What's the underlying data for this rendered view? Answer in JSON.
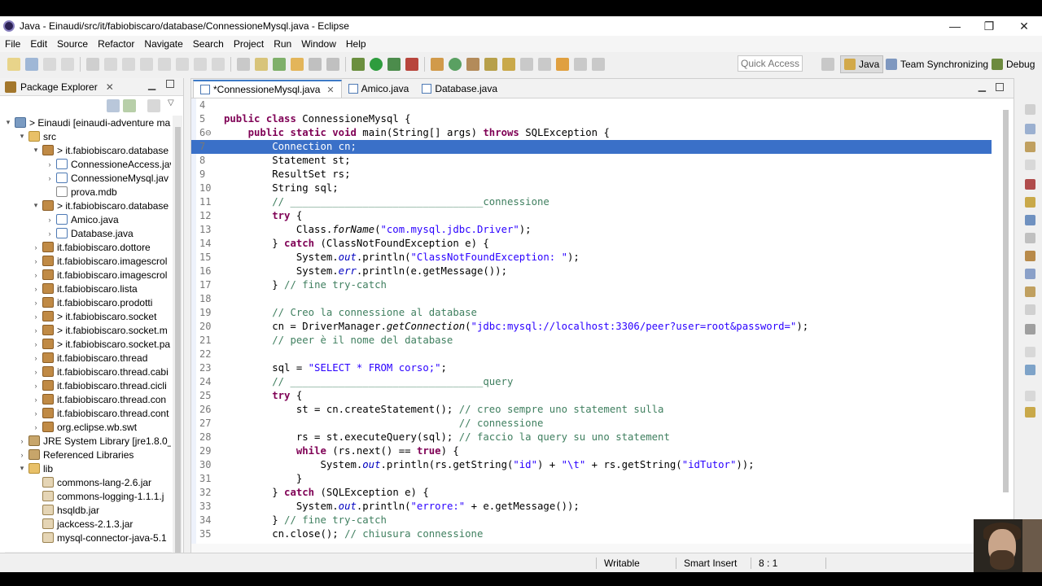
{
  "window": {
    "title": "Java - Einaudi/src/it/fabiobiscaro/database/ConnessioneMysql.java - Eclipse",
    "minimize": "—",
    "restore": "❐",
    "close": "✕"
  },
  "menu": [
    "File",
    "Edit",
    "Source",
    "Refactor",
    "Navigate",
    "Search",
    "Project",
    "Run",
    "Window",
    "Help"
  ],
  "toolbar": {
    "quick_access_placeholder": "Quick Access",
    "perspectives": [
      {
        "label": "Java",
        "active": true
      },
      {
        "label": "Team Synchronizing",
        "active": false
      },
      {
        "label": "Debug",
        "active": false
      }
    ]
  },
  "package_explorer": {
    "title": "Package Explorer",
    "close": "✕",
    "tree": [
      {
        "label": "> Einaudi  [einaudi-adventure ma",
        "icon": "project",
        "twisty": "▾",
        "level": 0
      },
      {
        "label": "src",
        "icon": "folder",
        "twisty": "▾",
        "level": 1
      },
      {
        "label": "> it.fabiobiscaro.database",
        "icon": "package",
        "twisty": "▾",
        "level": 2
      },
      {
        "label": "ConnessioneAccess.jav",
        "icon": "java",
        "twisty": "›",
        "level": 3
      },
      {
        "label": "ConnessioneMysql.jav",
        "icon": "java",
        "twisty": "›",
        "level": 3
      },
      {
        "label": "prova.mdb",
        "icon": "file",
        "twisty": "",
        "level": 3
      },
      {
        "label": "> it.fabiobiscaro.database",
        "icon": "package",
        "twisty": "▾",
        "level": 2
      },
      {
        "label": "Amico.java",
        "icon": "java",
        "twisty": "›",
        "level": 3
      },
      {
        "label": "Database.java",
        "icon": "java",
        "twisty": "›",
        "level": 3
      },
      {
        "label": "it.fabiobiscaro.dottore",
        "icon": "package",
        "twisty": "›",
        "level": 2
      },
      {
        "label": "it.fabiobiscaro.imagescrol",
        "icon": "package",
        "twisty": "›",
        "level": 2
      },
      {
        "label": "it.fabiobiscaro.imagescrol",
        "icon": "package",
        "twisty": "›",
        "level": 2
      },
      {
        "label": "it.fabiobiscaro.lista",
        "icon": "package",
        "twisty": "›",
        "level": 2
      },
      {
        "label": "it.fabiobiscaro.prodotti",
        "icon": "package",
        "twisty": "›",
        "level": 2
      },
      {
        "label": "> it.fabiobiscaro.socket",
        "icon": "package",
        "twisty": "›",
        "level": 2
      },
      {
        "label": "> it.fabiobiscaro.socket.m",
        "icon": "package",
        "twisty": "›",
        "level": 2
      },
      {
        "label": "> it.fabiobiscaro.socket.pa",
        "icon": "package",
        "twisty": "›",
        "level": 2
      },
      {
        "label": "it.fabiobiscaro.thread",
        "icon": "package",
        "twisty": "›",
        "level": 2
      },
      {
        "label": "it.fabiobiscaro.thread.cabi",
        "icon": "package",
        "twisty": "›",
        "level": 2
      },
      {
        "label": "it.fabiobiscaro.thread.cicli",
        "icon": "package",
        "twisty": "›",
        "level": 2
      },
      {
        "label": "it.fabiobiscaro.thread.con",
        "icon": "package",
        "twisty": "›",
        "level": 2
      },
      {
        "label": "it.fabiobiscaro.thread.cont",
        "icon": "package",
        "twisty": "›",
        "level": 2
      },
      {
        "label": "org.eclipse.wb.swt",
        "icon": "package",
        "twisty": "›",
        "level": 2
      },
      {
        "label": "JRE System Library [jre1.8.0_1",
        "icon": "library",
        "twisty": "›",
        "level": 1
      },
      {
        "label": "Referenced Libraries",
        "icon": "library",
        "twisty": "›",
        "level": 1
      },
      {
        "label": "lib",
        "icon": "folder",
        "twisty": "▾",
        "level": 1
      },
      {
        "label": "commons-lang-2.6.jar",
        "icon": "jar",
        "twisty": "",
        "level": 2
      },
      {
        "label": "commons-logging-1.1.1.j",
        "icon": "jar",
        "twisty": "",
        "level": 2
      },
      {
        "label": "hsqldb.jar",
        "icon": "jar",
        "twisty": "",
        "level": 2
      },
      {
        "label": "jackcess-2.1.3.jar",
        "icon": "jar",
        "twisty": "",
        "level": 2
      },
      {
        "label": "mysql-connector-java-5.1",
        "icon": "jar",
        "twisty": "",
        "level": 2
      }
    ]
  },
  "editor": {
    "tabs": [
      {
        "label": "*ConnessioneMysql.java",
        "active": true,
        "close": "✕"
      },
      {
        "label": "Amico.java",
        "active": false,
        "close": ""
      },
      {
        "label": "Database.java",
        "active": false,
        "close": ""
      }
    ],
    "selected_line": 7,
    "lines": [
      {
        "n": "4",
        "t": ""
      },
      {
        "n": "5",
        "t": "public class ConnessioneMysql {"
      },
      {
        "n": "6⊖",
        "t": "    public static void main(String[] args) throws SQLException {"
      },
      {
        "n": "7",
        "t": "        Connection cn;"
      },
      {
        "n": "8",
        "t": "        Statement st;"
      },
      {
        "n": "9",
        "t": "        ResultSet rs;"
      },
      {
        "n": "10",
        "t": "        String sql;"
      },
      {
        "n": "11",
        "t": "        // ________________________________connessione"
      },
      {
        "n": "12",
        "t": "        try {"
      },
      {
        "n": "13",
        "t": "            Class.forName(\"com.mysql.jdbc.Driver\");"
      },
      {
        "n": "14",
        "t": "        } catch (ClassNotFoundException e) {"
      },
      {
        "n": "15",
        "t": "            System.out.println(\"ClassNotFoundException: \");"
      },
      {
        "n": "16",
        "t": "            System.err.println(e.getMessage());"
      },
      {
        "n": "17",
        "t": "        } // fine try-catch"
      },
      {
        "n": "18",
        "t": ""
      },
      {
        "n": "19",
        "t": "        // Creo la connessione al database"
      },
      {
        "n": "20",
        "t": "        cn = DriverManager.getConnection(\"jdbc:mysql://localhost:3306/peer?user=root&password=\");"
      },
      {
        "n": "21",
        "t": "        // peer è il nome del database"
      },
      {
        "n": "22",
        "t": ""
      },
      {
        "n": "23",
        "t": "        sql = \"SELECT * FROM corso;\";"
      },
      {
        "n": "24",
        "t": "        // ________________________________query"
      },
      {
        "n": "25",
        "t": "        try {"
      },
      {
        "n": "26",
        "t": "            st = cn.createStatement(); // creo sempre uno statement sulla"
      },
      {
        "n": "27",
        "t": "                                       // connessione"
      },
      {
        "n": "28",
        "t": "            rs = st.executeQuery(sql); // faccio la query su uno statement"
      },
      {
        "n": "29",
        "t": "            while (rs.next() == true) {"
      },
      {
        "n": "30",
        "t": "                System.out.println(rs.getString(\"id\") + \"\\t\" + rs.getString(\"idTutor\"));"
      },
      {
        "n": "31",
        "t": "            }"
      },
      {
        "n": "32",
        "t": "        } catch (SQLException e) {"
      },
      {
        "n": "33",
        "t": "            System.out.println(\"errore:\" + e.getMessage());"
      },
      {
        "n": "34",
        "t": "        } // fine try-catch"
      },
      {
        "n": "35",
        "t": "        cn.close(); // chiusura connessione"
      }
    ]
  },
  "status": {
    "writable": "Writable",
    "insert_mode": "Smart Insert",
    "position": "8 : 1"
  },
  "colors": {
    "keyword": "#7f0055",
    "string": "#2a00ff",
    "comment": "#3f7f5f",
    "selection": "#3a70c8"
  }
}
